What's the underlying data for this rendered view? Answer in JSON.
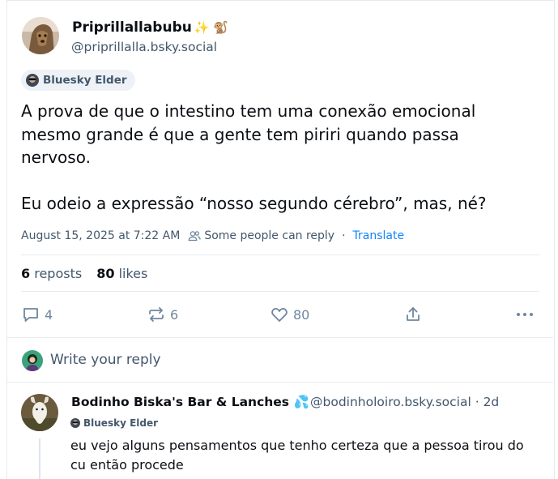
{
  "post": {
    "author": {
      "display_name": "Priprillallabubu",
      "name_emojis": "✨ 🐒",
      "handle": "@priprillalla.bsky.social",
      "badge": "Bluesky Elder"
    },
    "text_p1": "A prova de que o intestino tem uma conexão emocional mesmo grande é que a gente tem piriri quando passa nervoso.",
    "text_p2": "Eu odeio a expressão “nosso segundo cérebro”, mas, né?",
    "timestamp": "August 15, 2025 at 7:22 AM",
    "reply_setting": "Some people can reply",
    "separator": "·",
    "translate_label": "Translate",
    "reposts_count": "6",
    "reposts_label": "reposts",
    "likes_count": "80",
    "likes_label": "likes"
  },
  "actions": {
    "reply_count": "4",
    "repost_count": "6",
    "like_count": "80",
    "share_icon": "share-icon",
    "more_icon": "more-icon"
  },
  "compose": {
    "placeholder": "Write your reply"
  },
  "reply": {
    "display_name": "Bodinho Biska's Bar & Lanches",
    "name_emoji": "💦",
    "handle_time": "@bodinholoiro.bsky.social · 2d",
    "badge": "Bluesky Elder",
    "text": "eu vejo alguns pensamentos que tenho certeza que a pessoa tirou do cu então procede"
  },
  "colors": {
    "text_primary": "#0b0f14",
    "text_secondary": "#42576c",
    "link": "#1083fe",
    "icon": "#6f869f",
    "border": "#e6ebf0"
  }
}
